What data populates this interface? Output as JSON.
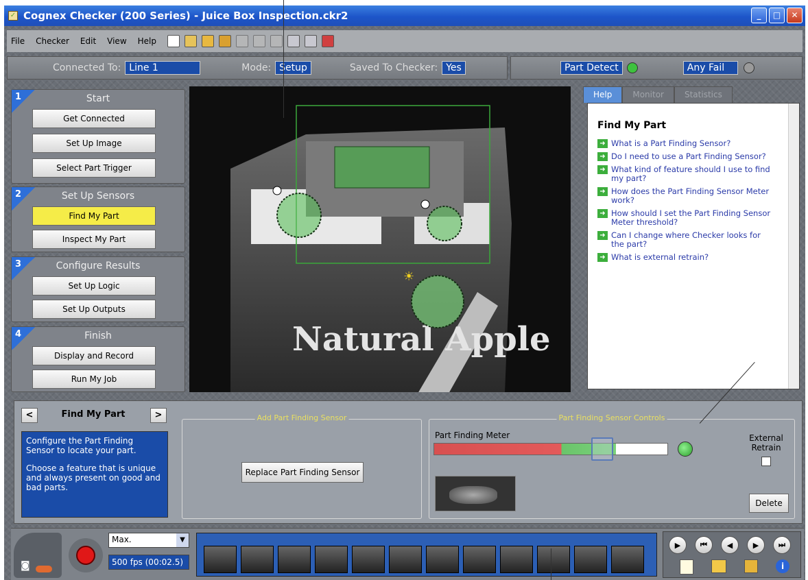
{
  "window": {
    "title": "Cognex Checker (200 Series) - Juice Box Inspection.ckr2",
    "controls": {
      "minimize": "_",
      "maximize": "□",
      "close": "✕"
    }
  },
  "menu": {
    "items": [
      "File",
      "Checker",
      "Edit",
      "View",
      "Help"
    ]
  },
  "toolbar_icons": [
    "new-icon",
    "check-icon",
    "open-icon",
    "save-icon",
    "undo-icon",
    "redo-icon",
    "cut-icon",
    "copy-icon",
    "paste-icon",
    "exit-icon"
  ],
  "status": {
    "connected_label": "Connected To:",
    "connected_value": "Line 1",
    "mode_label": "Mode:",
    "mode_value": "Setup",
    "saved_label": "Saved To Checker:",
    "saved_value": "Yes",
    "part_detect": "Part Detect",
    "any_fail": "Any Fail",
    "colors": {
      "part_detect_led": "#3ec23e",
      "any_fail_led": "#9a9a9a"
    }
  },
  "steps": [
    {
      "num": "1",
      "title": "Start",
      "buttons": [
        "Get Connected",
        "Set Up Image",
        "Select Part Trigger"
      ]
    },
    {
      "num": "2",
      "title": "Set Up Sensors",
      "buttons": [
        "Find My Part",
        "Inspect My Part"
      ]
    },
    {
      "num": "3",
      "title": "Configure Results",
      "buttons": [
        "Set Up Logic",
        "Set Up Outputs"
      ]
    },
    {
      "num": "4",
      "title": "Finish",
      "buttons": [
        "Display and Record",
        "Run My Job"
      ]
    }
  ],
  "active_step_button": "Find My Part",
  "camera": {
    "image_text": "Natural Apple"
  },
  "help": {
    "tabs": [
      "Help",
      "Monitor",
      "Statistics"
    ],
    "active_tab": "Help",
    "title": "Find My Part",
    "links": [
      "What is a Part Finding Sensor?",
      "Do I need to use a Part Finding Sensor?",
      "What kind of feature should I use to find my part?",
      "How does the Part Finding Sensor Meter work?",
      "How should I set the Part Finding Sensor Meter threshold?",
      "Can I change where Checker looks for the part?",
      "What is external retrain?"
    ]
  },
  "bottom": {
    "prev": "<",
    "next": ">",
    "title": "Find My Part",
    "description_1": "Configure the Part Finding Sensor to locate your part.",
    "description_2": "Choose a feature that is unique and always present on good and bad parts.",
    "add_group": "Add Part Finding Sensor",
    "replace_button": "Replace Part Finding Sensor",
    "controls_group": "Part Finding Sensor Controls",
    "meter_label": "Part Finding Meter",
    "meter_level": 0.78,
    "meter_threshold": 0.72,
    "external_retrain": "External Retrain",
    "external_retrain_checked": false,
    "delete_button": "Delete"
  },
  "film": {
    "speed_select": "Max.",
    "fps": "500 fps (00:02.5)",
    "frame_count": 12,
    "playback_icons": [
      "play-icon",
      "skip-start-icon",
      "step-back-icon",
      "step-forward-icon",
      "skip-end-icon"
    ],
    "file_icons": [
      "new-file-icon",
      "open-folder-icon",
      "save-icon",
      "info-icon"
    ]
  }
}
